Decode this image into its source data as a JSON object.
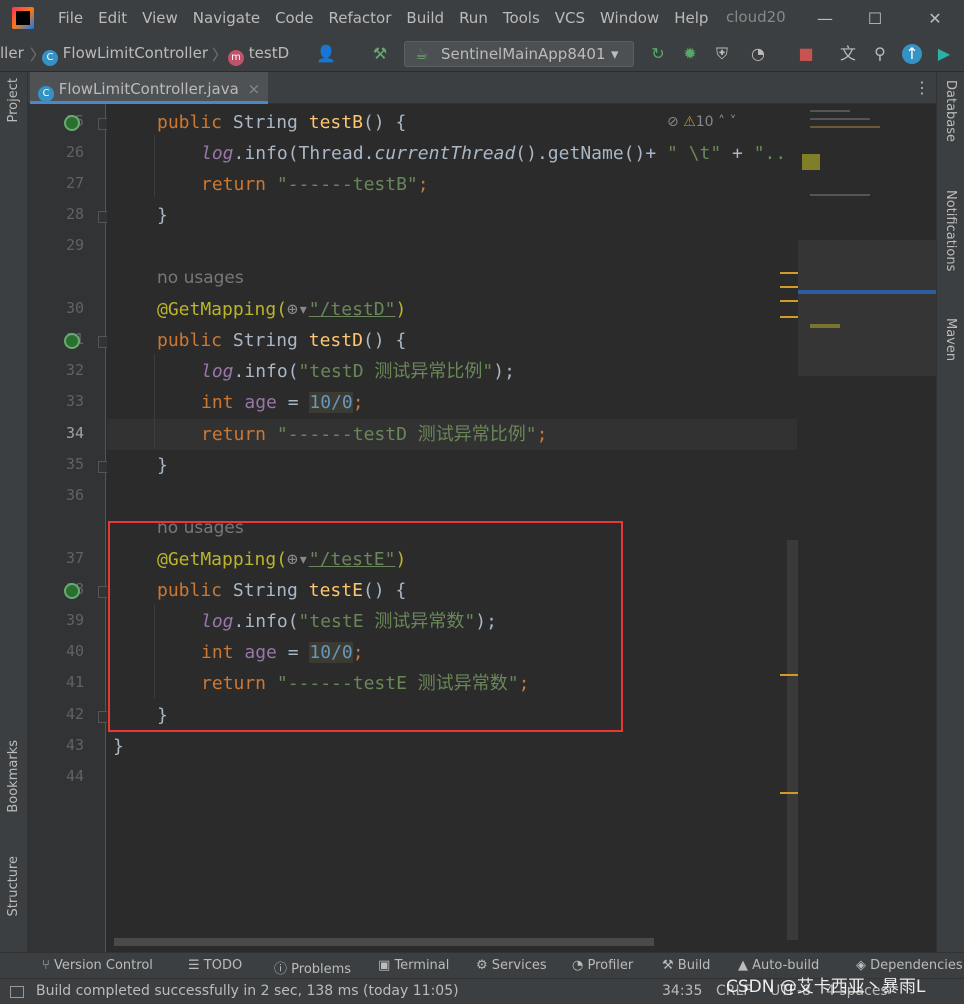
{
  "menubar": {
    "items": [
      "File",
      "Edit",
      "View",
      "Navigate",
      "Code",
      "Refactor",
      "Build",
      "Run",
      "Tools",
      "VCS",
      "Window",
      "Help"
    ],
    "project": "cloud20",
    "min": "—",
    "max": "☐",
    "close": "✕"
  },
  "navbar": {
    "crumb1": "ller",
    "crumb2": "FlowLimitController",
    "crumb3": "testD",
    "run_config": "SentinelMainApp8401",
    "m_letter": "m",
    "c_letter": "C"
  },
  "left_tools": {
    "project": "Project",
    "bookmarks": "Bookmarks",
    "structure": "Structure"
  },
  "right_tools": {
    "database": "Database",
    "notifications": "Notifications",
    "maven": "Maven"
  },
  "tab": {
    "label": "FlowLimitController.java",
    "close": "×"
  },
  "inspections": {
    "warnings": "10"
  },
  "line_numbers": [
    "25",
    "26",
    "27",
    "28",
    "29",
    "",
    "30",
    "31",
    "32",
    "33",
    "34",
    "35",
    "36",
    "",
    "37",
    "38",
    "39",
    "40",
    "41",
    "42",
    "43",
    "44"
  ],
  "code": {
    "l25": {
      "kw": "public",
      "type": "String",
      "name": "testB",
      "rest": "() {"
    },
    "l26": {
      "log": "log",
      "info": ".info(",
      "thread": "Thread.",
      "ct": "currentThread",
      "rest": "().getName()+ ",
      "s1": "\" \\t\"",
      "plus": " + ",
      "s2": "\".."
    },
    "l27": {
      "kw": "return",
      "str": "\"------testB\"",
      "semi": ";"
    },
    "l28": {
      "brace": "}"
    },
    "usage1": "no usages",
    "l30": {
      "ann": "@GetMapping(",
      "path": "\"/testD\"",
      "close": ")"
    },
    "l31": {
      "kw": "public",
      "type": "String",
      "name": "testD",
      "rest": "() {"
    },
    "l32": {
      "log": "log",
      "info": ".info(",
      "str": "\"testD 测试异常比例\"",
      "close": ");"
    },
    "l33": {
      "kw": "int",
      "var": "age",
      "eq": " = ",
      "num": "10/0",
      "semi": ";"
    },
    "l34": {
      "kw": "return",
      "str": "\"------testD 测试异常比例\"",
      "semi": ";"
    },
    "l35": {
      "brace": "}"
    },
    "usage2": "no usages",
    "l37": {
      "ann": "@GetMapping(",
      "path": "\"/testE\"",
      "close": ")"
    },
    "l38": {
      "kw": "public",
      "type": "String",
      "name": "testE",
      "rest": "() {"
    },
    "l39": {
      "log": "log",
      "info": ".info(",
      "str": "\"testE 测试异常数\"",
      "close": ");"
    },
    "l40": {
      "kw": "int",
      "var": "age",
      "eq": " = ",
      "num": "10/0",
      "semi": ";"
    },
    "l41": {
      "kw": "return",
      "str": "\"------testE 测试异常数\"",
      "semi": ";"
    },
    "l42": {
      "brace": "}"
    },
    "l43": {
      "brace": "}"
    }
  },
  "bottom_tools": [
    "Version Control",
    "TODO",
    "Problems",
    "Terminal",
    "Services",
    "Profiler",
    "Build",
    "Auto-build",
    "Dependencies"
  ],
  "status": {
    "message": "Build completed successfully in 2 sec, 138 ms (today 11:05)",
    "position": "34:35",
    "line_sep": "CRLF",
    "encoding": "UTF-8",
    "indent": "4 spaces"
  },
  "watermark": "CSDN @艾卡西亚丶暴雨L",
  "colors": {
    "keyword": "#cc7832",
    "function": "#ffc66d",
    "string": "#6a8759",
    "annotation": "#bbb529",
    "number": "#6897bb",
    "highlight_box": "#e53935"
  }
}
